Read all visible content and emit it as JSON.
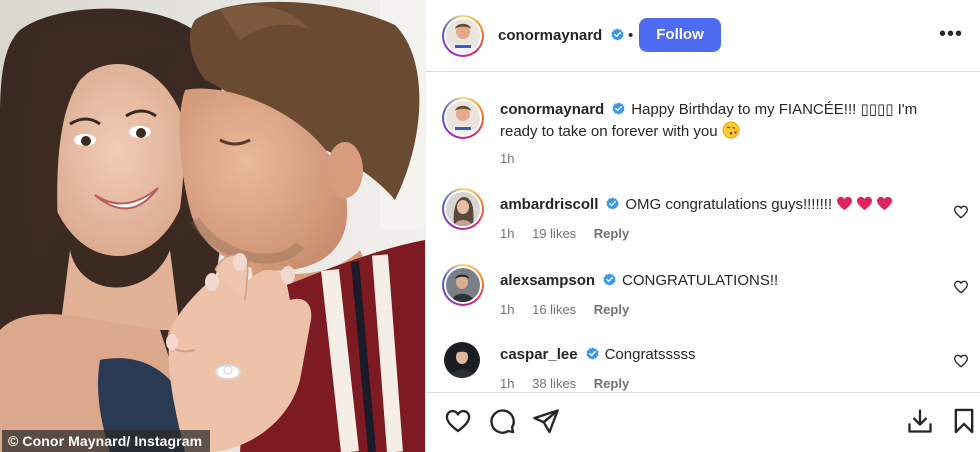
{
  "photo": {
    "credit": "© Conor Maynard/ Instagram"
  },
  "header": {
    "username": "conormaynard",
    "separator": "•",
    "follow_label": "Follow",
    "more_label": "•••"
  },
  "caption": {
    "username": "conormaynard",
    "text_before_emoji": "Happy Birthday to my FIANCÉE!!! ▯▯▯▯ I'm ready to take on forever with you",
    "time": "1h"
  },
  "comments": [
    {
      "username": "ambardriscoll",
      "text": "OMG congratulations guys!!!!!!!",
      "time": "1h",
      "likes": "19 likes",
      "reply": "Reply",
      "verified": true,
      "hearts": 3
    },
    {
      "username": "alexsampson",
      "text": "CONGRATULATIONS!!",
      "time": "1h",
      "likes": "16 likes",
      "reply": "Reply",
      "verified": true,
      "hearts": 0
    },
    {
      "username": "caspar_lee",
      "text": "Congratsssss",
      "time": "1h",
      "likes": "38 likes",
      "reply": "Reply",
      "verified": true,
      "hearts": 0
    }
  ],
  "icons": {
    "verified": "verified-badge-icon",
    "like": "heart-icon",
    "comment": "comment-icon",
    "share": "share-icon",
    "save": "bookmark-icon",
    "download": "download-icon",
    "more": "more-options-icon"
  },
  "colors": {
    "follow_button": "#4f6bf2",
    "verified": "#3897f0",
    "emoji_heart": "#e0245e",
    "muted_text": "#737373"
  }
}
